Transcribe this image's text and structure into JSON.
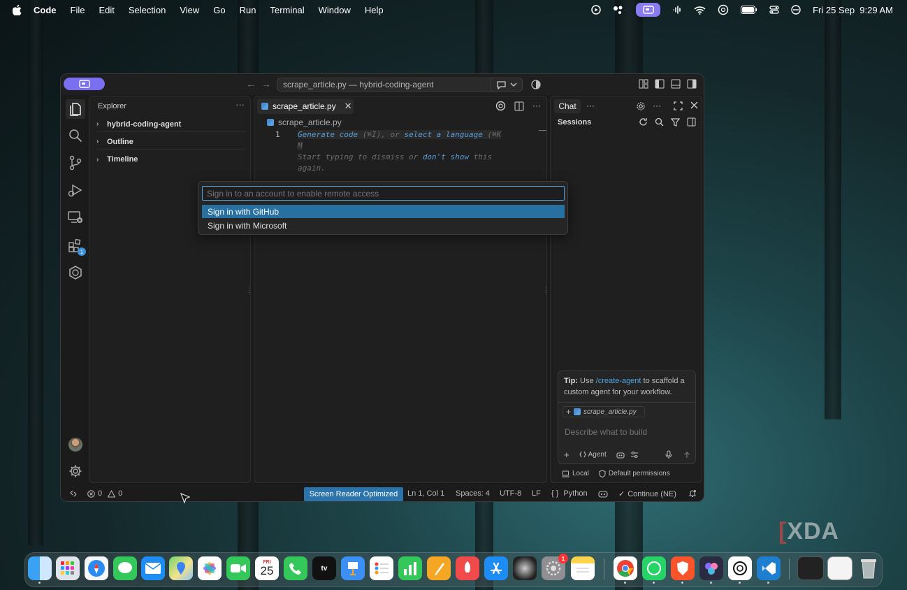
{
  "menubar": {
    "app_name": "Code",
    "items": [
      "File",
      "Edit",
      "Selection",
      "View",
      "Go",
      "Run",
      "Terminal",
      "Window",
      "Help"
    ],
    "datetime": "Fri 25 Sep  9:29 AM"
  },
  "window": {
    "command_center": "scrape_article.py — hybrid-coding-agent"
  },
  "activity_bar": {
    "extensions_badge": "1"
  },
  "sidebar": {
    "title": "Explorer",
    "more": "···",
    "sections": [
      "hybrid-coding-agent",
      "Outline",
      "Timeline"
    ]
  },
  "editor": {
    "tab_label": "scrape_article.py",
    "breadcrumb": "scrape_article.py",
    "line_number": "1",
    "ghost": {
      "generate": "Generate code",
      "generate_key": " (⌘I), or ",
      "select_lang": "select a language",
      "select_key": " (⌘K M",
      "line2_a": "Start typing to dismiss or ",
      "dont_show": "don't show",
      "line2_b": " this",
      "line3": "again."
    }
  },
  "quick_pick": {
    "placeholder": "Sign in to an account to enable remote access",
    "items": [
      "Sign in with GitHub",
      "Sign in with Microsoft"
    ]
  },
  "chat": {
    "tab": "Chat",
    "more": "···",
    "sessions": "Sessions",
    "tip_label": "Tip:",
    "tip_pre": " Use ",
    "tip_cmd": "/create-agent",
    "tip_post": " to scaffold a custom agent for your workflow.",
    "attachment": "scrape_article.py",
    "input_placeholder": "Describe what to build",
    "agent_label": "Agent",
    "footer_local": "Local",
    "footer_permissions": "Default permissions"
  },
  "statusbar": {
    "errors": "0",
    "warnings": "0",
    "screen_reader": "Screen Reader Optimized",
    "position": "Ln 1, Col 1",
    "spaces": "Spaces: 4",
    "encoding": "UTF-8",
    "eol": "LF",
    "language_braces": "{ }",
    "language": "Python",
    "continue": "Continue (NE)"
  },
  "dock": {
    "calendar_month": "FRI",
    "calendar_day": "25",
    "settings_badge": "1",
    "tv_label": "tv"
  },
  "watermark": "XDA",
  "colors": {
    "accent_blue": "#2870a0",
    "status_highlight": "#2b73ab",
    "window_pill": "#7a6ff0",
    "link": "#4fa3e0"
  }
}
